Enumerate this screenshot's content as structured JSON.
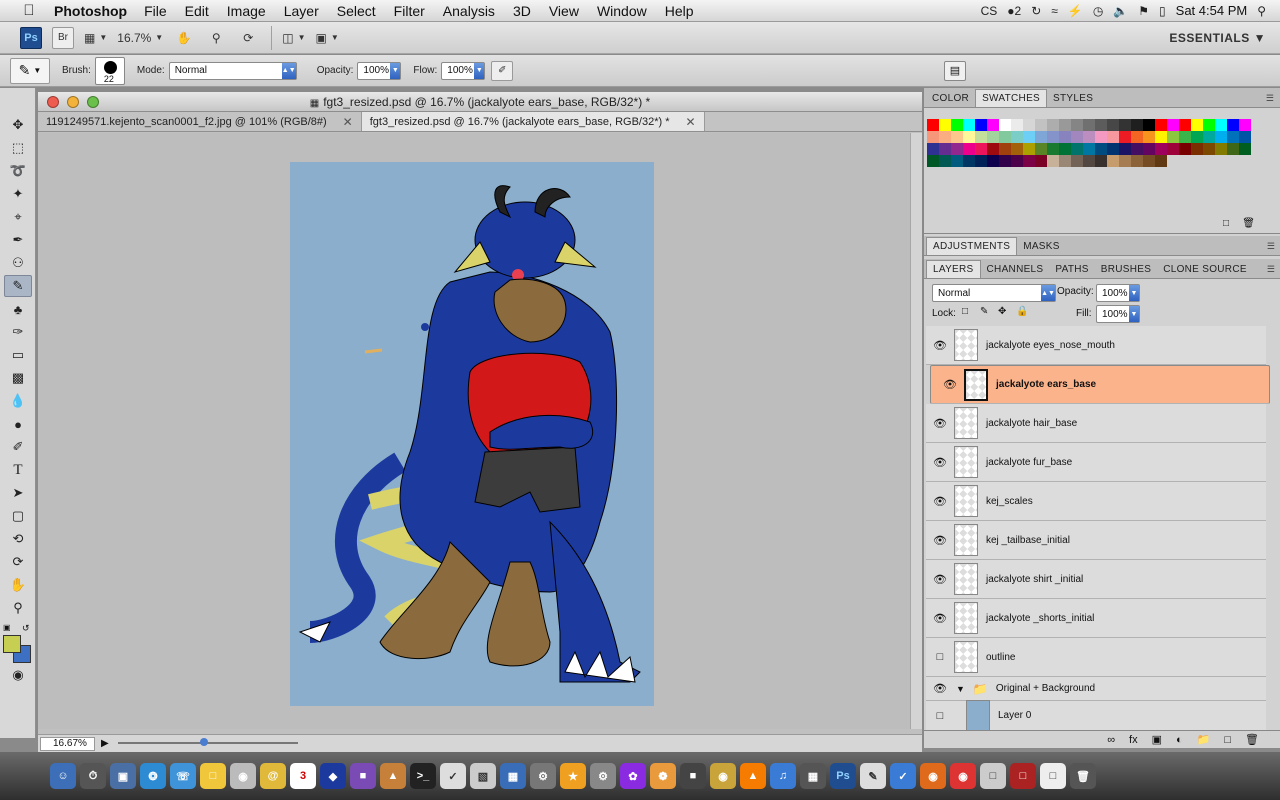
{
  "menubar": {
    "app_name": "Photoshop",
    "menus": [
      "File",
      "Edit",
      "Image",
      "Layer",
      "Select",
      "Filter",
      "Analysis",
      "3D",
      "View",
      "Window",
      "Help"
    ],
    "status_badge": "2",
    "clock": "Sat 4:54 PM"
  },
  "appbar": {
    "logo": "Ps",
    "bridge": "Br",
    "zoom": "16.7%",
    "workspace": "ESSENTIALS"
  },
  "options": {
    "brush_label": "Brush:",
    "brush_size": "22",
    "mode_label": "Mode:",
    "mode_value": "Normal",
    "opacity_label": "Opacity:",
    "opacity_value": "100%",
    "flow_label": "Flow:",
    "flow_value": "100%"
  },
  "document": {
    "title": "fgt3_resized.psd @ 16.7% (jackalyote ears_base, RGB/32*) *",
    "tabs": [
      {
        "label": "1191249571.kejento_scan0001_f2.jpg @ 101% (RGB/8#)"
      },
      {
        "label": "fgt3_resized.psd @ 16.7% (jackalyote ears_base, RGB/32*) *"
      }
    ],
    "zoom_readout": "16.67%"
  },
  "swatches_panel": {
    "tabs": [
      "COLOR",
      "SWATCHES",
      "STYLES"
    ],
    "active_tab": "SWATCHES",
    "colors": [
      "#ff0000",
      "#ffff00",
      "#00ff00",
      "#00ffff",
      "#0000ff",
      "#ff00ff",
      "#ffffff",
      "#ebebeb",
      "#d6d6d6",
      "#c2c2c2",
      "#adadad",
      "#999999",
      "#858585",
      "#707070",
      "#5c5c5c",
      "#474747",
      "#333333",
      "#1f1f1f",
      "#000000",
      "#ff0000",
      "#ff00ff",
      "#ff0000",
      "#ffff00",
      "#00ff00",
      "#00ffff",
      "#0000ff",
      "#ff00ff",
      "#f7977a",
      "#f9ad81",
      "#fdc68a",
      "#fff79a",
      "#c4df9b",
      "#a3d39c",
      "#82ca9d",
      "#7bcdc8",
      "#6ecff6",
      "#7ea7d8",
      "#8493ca",
      "#8882be",
      "#a187be",
      "#bc8dbf",
      "#f49ac2",
      "#f6989d",
      "#ed1c24",
      "#f26522",
      "#f7941d",
      "#fff200",
      "#8dc73f",
      "#39b54a",
      "#00a651",
      "#00a99d",
      "#00aeef",
      "#0072bc",
      "#0054a6",
      "#2e3192",
      "#662d91",
      "#92278f",
      "#ec008c",
      "#ed145b",
      "#9e0b0f",
      "#a0410d",
      "#a36209",
      "#aba000",
      "#598527",
      "#1a7b30",
      "#007236",
      "#00746b",
      "#0076a3",
      "#004b80",
      "#003471",
      "#1b1464",
      "#440e62",
      "#630460",
      "#9e005d",
      "#9e0039",
      "#790000",
      "#7b2e00",
      "#7d4900",
      "#827b00",
      "#406618",
      "#005e20",
      "#005826",
      "#005952",
      "#005b7f",
      "#003663",
      "#002157",
      "#0d004c",
      "#32004b",
      "#4b0049",
      "#7b0046",
      "#7a0026",
      "#c7b299",
      "#998675",
      "#736357",
      "#534741",
      "#37302d",
      "#c69c6d",
      "#a67c52",
      "#8c6239",
      "#754c24",
      "#603913"
    ]
  },
  "adjust_panel": {
    "tabs": [
      "ADJUSTMENTS",
      "MASKS"
    ]
  },
  "layers_panel": {
    "tabs": [
      "LAYERS",
      "CHANNELS",
      "PATHS",
      "BRUSHES",
      "CLONE SOURCE"
    ],
    "blend_mode": "Normal",
    "opacity_label": "Opacity:",
    "opacity_value": "100%",
    "lock_label": "Lock:",
    "fill_label": "Fill:",
    "fill_value": "100%",
    "layers": [
      {
        "name": "jackalyote eyes_nose_mouth",
        "visible": true,
        "selected": false
      },
      {
        "name": "jackalyote ears_base",
        "visible": true,
        "selected": true
      },
      {
        "name": "jackalyote hair_base",
        "visible": true,
        "selected": false
      },
      {
        "name": "jackalyote fur_base",
        "visible": true,
        "selected": false
      },
      {
        "name": "kej_scales",
        "visible": true,
        "selected": false
      },
      {
        "name": "kej _tailbase_initial",
        "visible": true,
        "selected": false
      },
      {
        "name": "jackalyote shirt _initial",
        "visible": true,
        "selected": false
      },
      {
        "name": "jackalyote _shorts_initial",
        "visible": true,
        "selected": false
      },
      {
        "name": "outline",
        "visible": false,
        "selected": false
      },
      {
        "name": "Original + Background",
        "visible": true,
        "selected": false,
        "group": true
      },
      {
        "name": "Layer 0",
        "visible": false,
        "selected": false
      }
    ]
  },
  "dock": {
    "calendar_day": "3",
    "ps_label": "Ps"
  },
  "colors": {
    "foreground": "#c6cf52",
    "background": "#3d6fc2",
    "selection": "#fbb38c",
    "canvas_bg": "#8aaecb"
  }
}
